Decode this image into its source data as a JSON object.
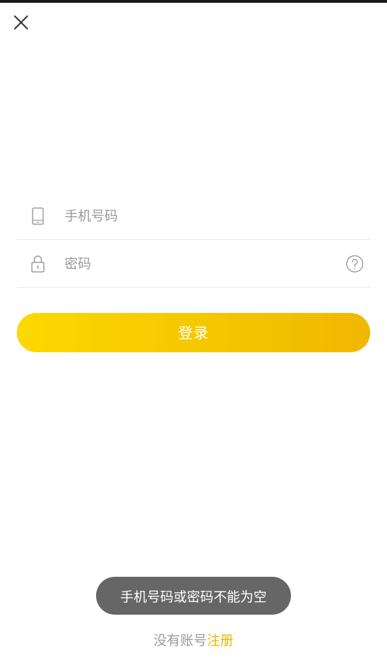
{
  "header": {
    "close_icon": "close-icon"
  },
  "form": {
    "phone": {
      "icon": "phone-icon",
      "placeholder": "手机号码",
      "value": ""
    },
    "password": {
      "icon": "lock-icon",
      "placeholder": "密码",
      "value": "",
      "help_icon": "question-circle-icon"
    },
    "login_label": "登录"
  },
  "toast": {
    "message": "手机号码或密码不能为空"
  },
  "footer": {
    "no_account_text": "没有账号",
    "register_label": "注册"
  },
  "colors": {
    "accent_start": "#fcd800",
    "accent_end": "#f0b700",
    "link": "#f2b400",
    "toast_bg": "#666666",
    "placeholder": "#9a9a9a",
    "divider": "#e8e8e8"
  }
}
